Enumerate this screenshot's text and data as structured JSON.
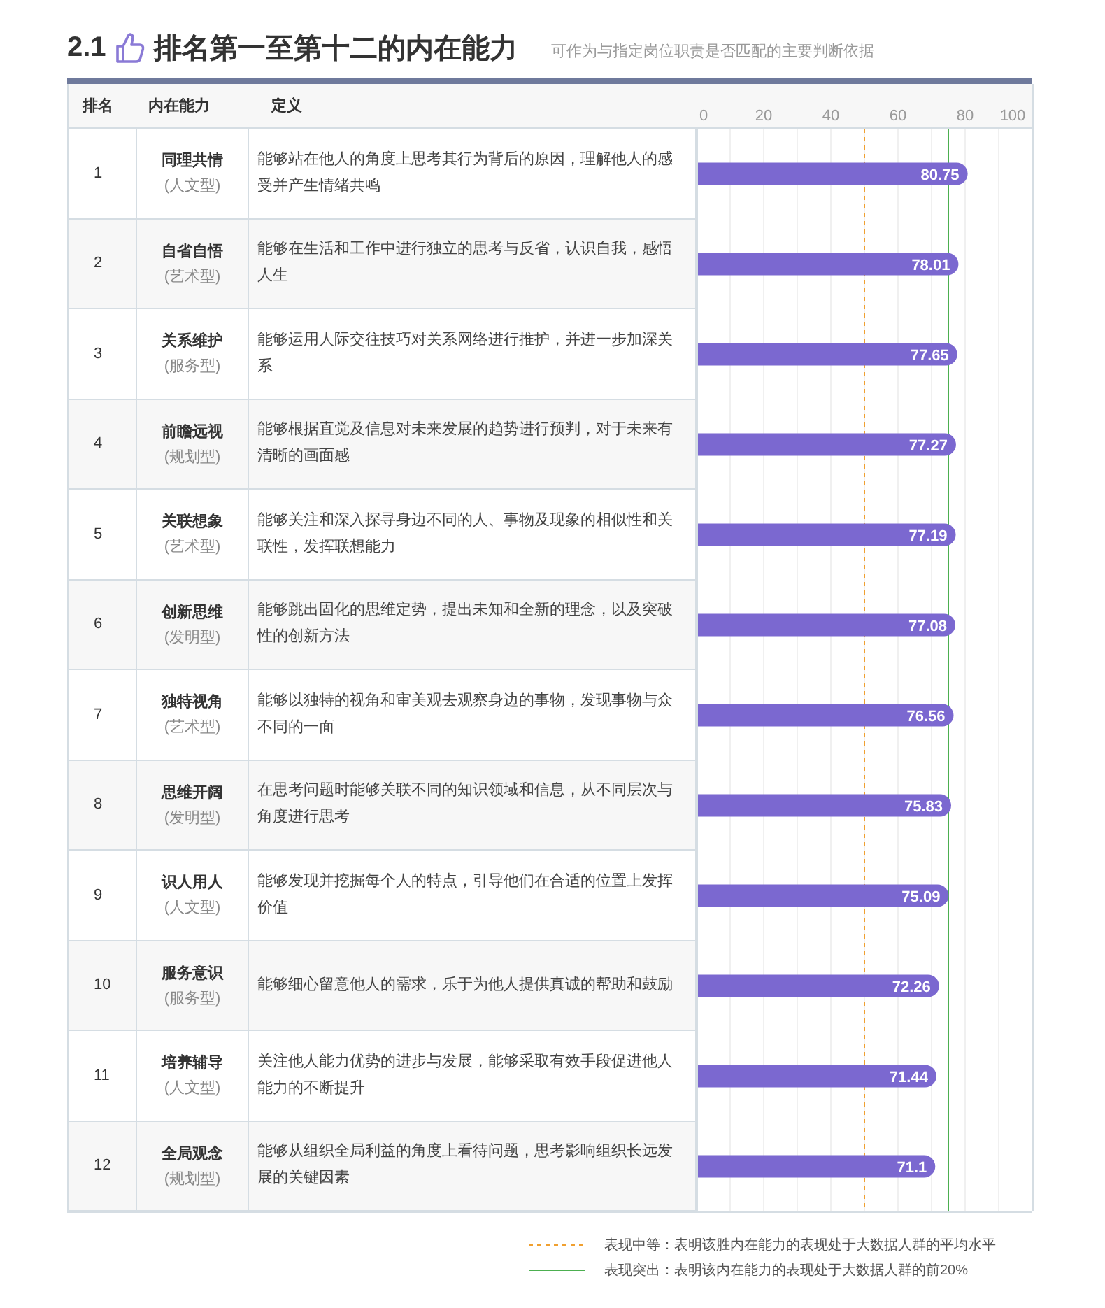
{
  "heading": {
    "number": "2.1",
    "title": "排名第一至第十二的内在能力",
    "subtitle": "可作为与指定岗位职责是否匹配的主要判断依据"
  },
  "table": {
    "columns": [
      "排名",
      "内在能力",
      "定义"
    ],
    "rows": [
      {
        "rank": "1",
        "name": "同理共情",
        "type": "(人文型)",
        "definition": "能够站在他人的角度上思考其行为背后的原因，理解他人的感受并产生情绪共鸣"
      },
      {
        "rank": "2",
        "name": "自省自悟",
        "type": "(艺术型)",
        "definition": "能够在生活和工作中进行独立的思考与反省，认识自我，感悟人生"
      },
      {
        "rank": "3",
        "name": "关系维护",
        "type": "(服务型)",
        "definition": "能够运用人际交往技巧对关系网络进行推护，并进一步加深关系"
      },
      {
        "rank": "4",
        "name": "前瞻远视",
        "type": "(规划型)",
        "definition": "能够根据直觉及信息对未来发展的趋势进行预判，对于未来有清晰的画面感"
      },
      {
        "rank": "5",
        "name": "关联想象",
        "type": "(艺术型)",
        "definition": "能够关注和深入探寻身边不同的人、事物及现象的相似性和关联性，发挥联想能力"
      },
      {
        "rank": "6",
        "name": "创新思维",
        "type": "(发明型)",
        "definition": "能够跳出固化的思维定势，提出未知和全新的理念，以及突破性的创新方法"
      },
      {
        "rank": "7",
        "name": "独特视角",
        "type": "(艺术型)",
        "definition": "能够以独特的视角和审美观去观察身边的事物，发现事物与众不同的一面"
      },
      {
        "rank": "8",
        "name": "思维开阔",
        "type": "(发明型)",
        "definition": "在思考问题时能够关联不同的知识领域和信息，从不同层次与角度进行思考"
      },
      {
        "rank": "9",
        "name": "识人用人",
        "type": "(人文型)",
        "definition": "能够发现并挖掘每个人的特点，引导他们在合适的位置上发挥价值"
      },
      {
        "rank": "10",
        "name": "服务意识",
        "type": "(服务型)",
        "definition": "能够细心留意他人的需求，乐于为他人提供真诚的帮助和鼓励"
      },
      {
        "rank": "11",
        "name": "培养辅导",
        "type": "(人文型)",
        "definition": "关注他人能力优势的进步与发展，能够采取有效手段促进他人能力的不断提升"
      },
      {
        "rank": "12",
        "name": "全局观念",
        "type": "(规划型)",
        "definition": "能够从组织全局利益的角度上看待问题，思考影响组织长远发展的关键因素"
      }
    ],
    "chart_data": {
      "type": "bar",
      "orientation": "horizontal",
      "grid": true,
      "series": [
        {
          "color": "#7b68d0",
          "values": [
            80.75,
            78.01,
            77.65,
            77.27,
            77.19,
            77.08,
            76.56,
            75.83,
            75.09,
            72.26,
            71.44,
            71.1
          ]
        }
      ],
      "value_labels": [
        "80.75",
        "78.01",
        "77.65",
        "77.27",
        "77.19",
        "77.08",
        "76.56",
        "75.83",
        "75.09",
        "72.26",
        "71.44",
        "71.1"
      ],
      "xlim": [
        0,
        100
      ],
      "xticks": [
        0,
        20,
        40,
        60,
        80,
        100
      ],
      "ref_lines": [
        {
          "axis": "x",
          "value": 50,
          "color": "#f0a030"
        },
        {
          "axis": "x",
          "value": 75,
          "color": "#4caf50"
        }
      ]
    }
  },
  "legend": [
    {
      "kind": "dashed",
      "color": "#f0a030",
      "text": "表现中等：表明该胜内在能力的表现处于大数据人群的平均水平"
    },
    {
      "kind": "solid",
      "color": "#4caf50",
      "text": "表现突出：表明该内在能力的表现处于大数据人群的前20%"
    }
  ]
}
